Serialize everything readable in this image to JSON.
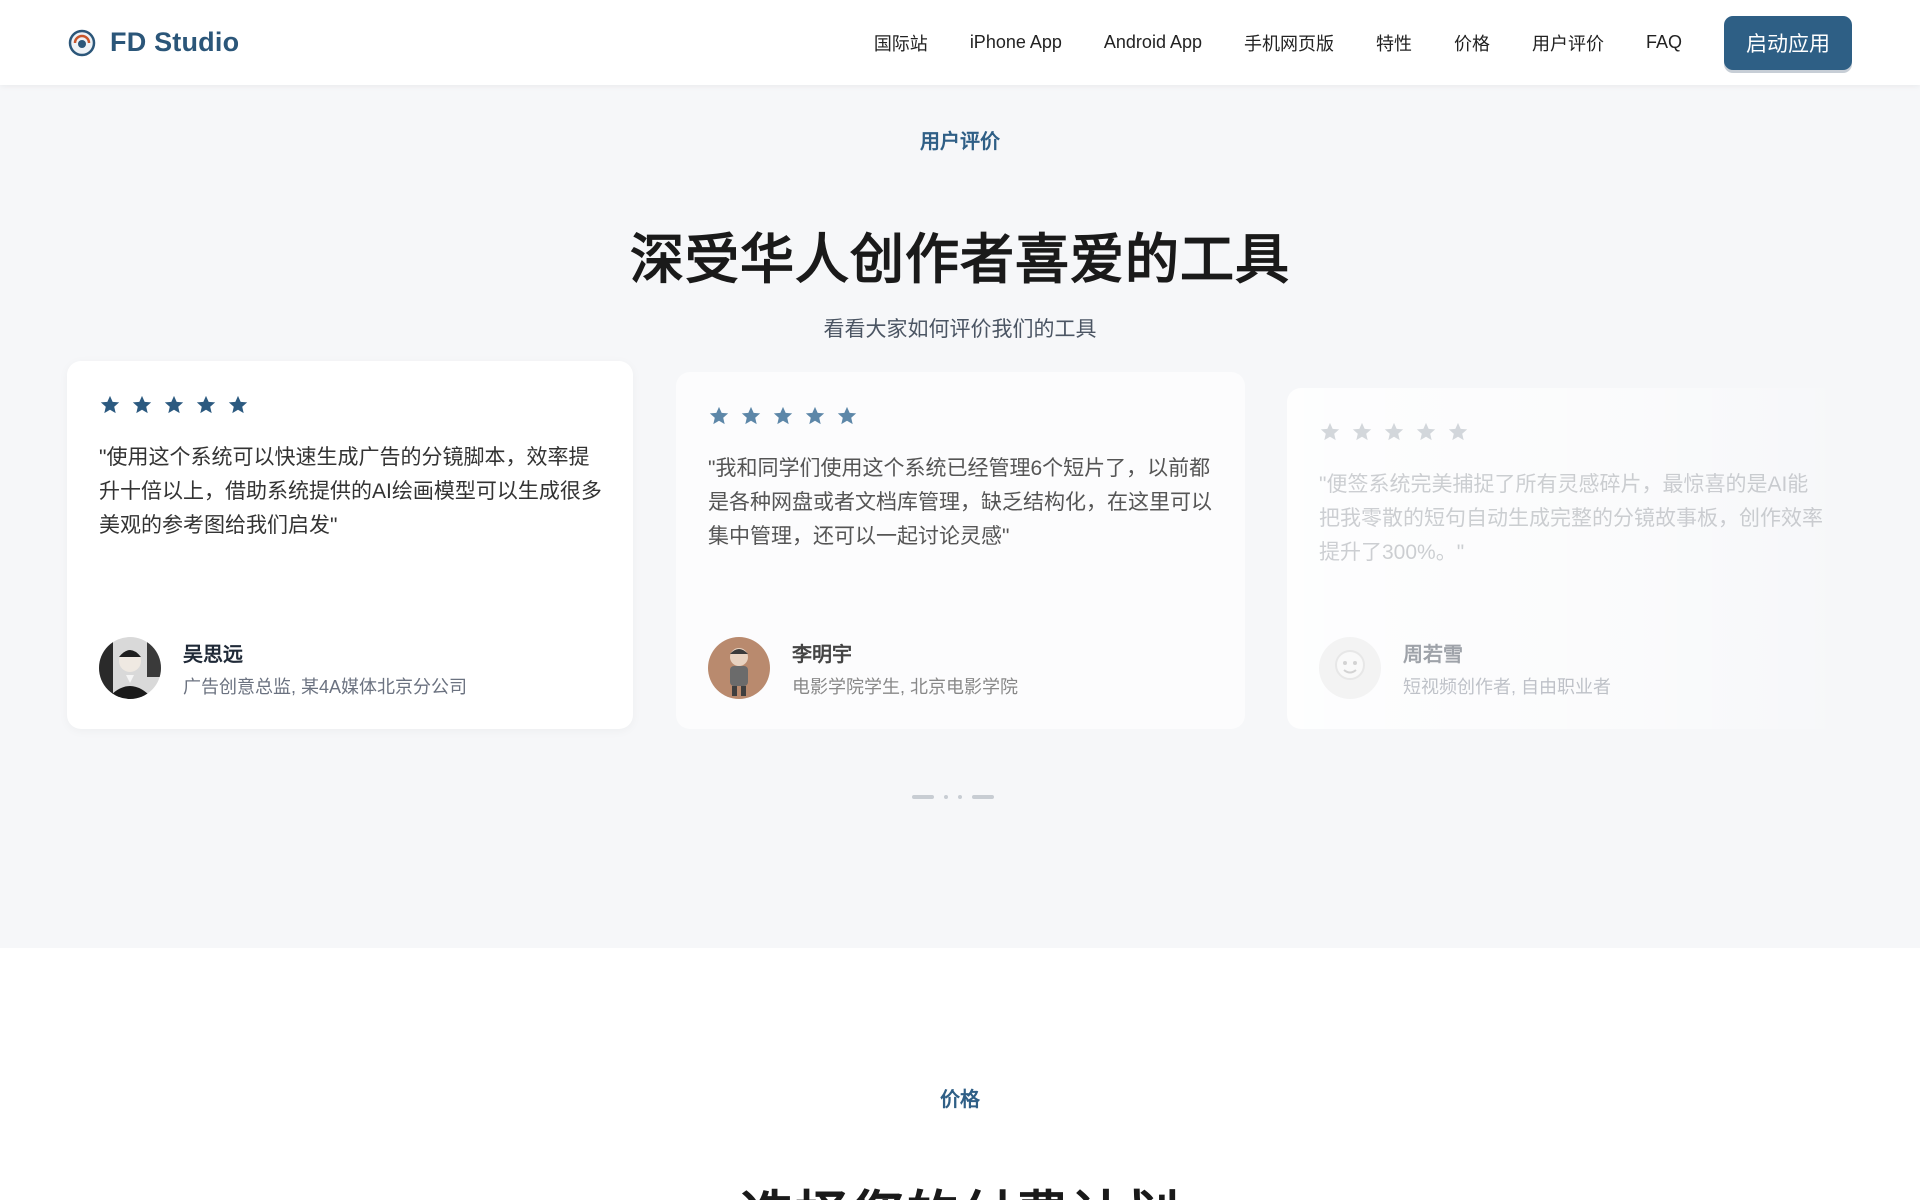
{
  "brand": {
    "name": "FD Studio",
    "logo_icon": "fd-logo-icon"
  },
  "nav": {
    "items": [
      "国际站",
      "iPhone App",
      "Android App",
      "手机网页版",
      "特性",
      "价格",
      "用户评价",
      "FAQ"
    ],
    "cta_label": "启动应用"
  },
  "colors": {
    "accent": "#2e5f85",
    "brand_text": "#2b5679",
    "page_bg": "#f6f7f9"
  },
  "testimonials": {
    "eyebrow": "用户评价",
    "title": "深受华人创作者喜爱的工具",
    "subtitle": "看看大家如何评价我们的工具",
    "cards": [
      {
        "rating": 5,
        "quote": "\"使用这个系统可以快速生成广告的分镜脚本，效率提升十倍以上，借助系统提供的AI绘画模型可以生成很多美观的参考图给我们启发\"",
        "name": "吴思远",
        "role": "广告创意总监, 某4A媒体北京分公司"
      },
      {
        "rating": 5,
        "quote": "\"我和同学们使用这个系统已经管理6个短片了，以前都是各种网盘或者文档库管理，缺乏结构化，在这里可以集中管理，还可以一起讨论灵感\"",
        "name": "李明宇",
        "role": "电影学院学生, 北京电影学院"
      },
      {
        "rating": 5,
        "quote": "\"便签系统完美捕捉了所有灵感碎片，最惊喜的是AI能把我零散的短句自动生成完整的分镜故事板，创作效率提升了300%。\"",
        "name": "周若雪",
        "role": "短视频创作者, 自由职业者"
      }
    ]
  },
  "pricing": {
    "eyebrow": "价格",
    "title": "选择您的付费计划"
  }
}
